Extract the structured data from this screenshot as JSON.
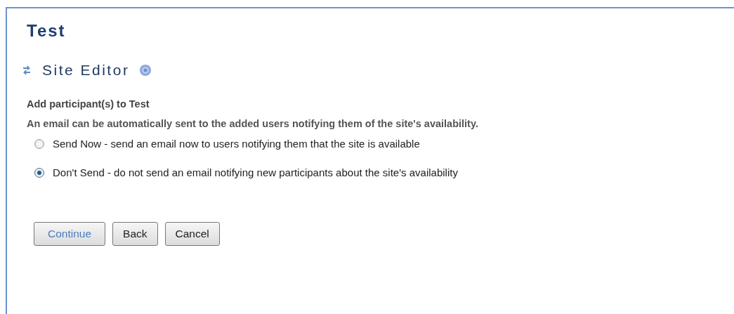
{
  "page": {
    "title": "Test"
  },
  "tool": {
    "title": "Site Editor"
  },
  "heading": "Add participant(s) to Test",
  "instructions": "An email can be automatically sent to the added users notifying them of the site's availability.",
  "options": [
    {
      "label": "Send Now - send an email now to users notifying them that the site is available",
      "selected": false
    },
    {
      "label": "Don't Send - do not send an email notifying new participants about the site's availability",
      "selected": true
    }
  ],
  "buttons": [
    {
      "label": "Continue",
      "kind": "primary"
    },
    {
      "label": "Back",
      "kind": "normal"
    },
    {
      "label": "Cancel",
      "kind": "normal"
    }
  ]
}
